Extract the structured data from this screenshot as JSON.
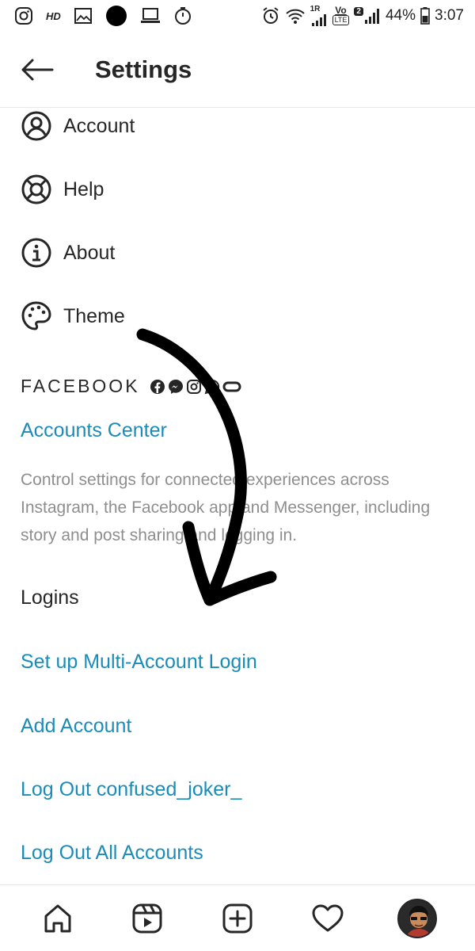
{
  "status_bar": {
    "hd": "HD",
    "signal_tag": "1R",
    "sim_tag": "2",
    "volte_top": "Vo",
    "volte_bottom": "LTE",
    "battery": "44%",
    "time": "3:07"
  },
  "header": {
    "title": "Settings"
  },
  "menu": [
    {
      "label": "Account",
      "icon": "account-icon"
    },
    {
      "label": "Help",
      "icon": "lifebuoy-icon"
    },
    {
      "label": "About",
      "icon": "info-icon"
    },
    {
      "label": "Theme",
      "icon": "palette-icon"
    }
  ],
  "facebook": {
    "title": "FACEBOOK",
    "accounts_center": "Accounts Center",
    "description": "Control settings for connected experiences across Instagram, the Facebook app and Messenger, including story and post sharing and logging in."
  },
  "logins": {
    "title": "Logins",
    "items": [
      "Set up Multi-Account Login",
      "Add Account",
      "Log Out confused_joker_",
      "Log Out All Accounts"
    ]
  },
  "bottom_nav": [
    "home-icon",
    "reels-icon",
    "new-post-icon",
    "activity-heart-icon",
    "profile-avatar"
  ],
  "colors": {
    "link": "#1a8cba",
    "text": "#262626",
    "muted": "#8e8e8e"
  }
}
